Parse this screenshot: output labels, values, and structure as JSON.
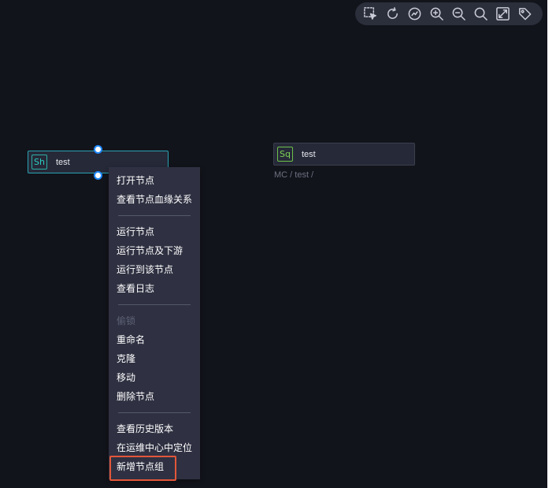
{
  "toolbar": {
    "tools": [
      {
        "icon": "select-box-icon"
      },
      {
        "icon": "refresh-icon"
      },
      {
        "icon": "auto-layout-icon"
      },
      {
        "icon": "zoom-in-icon"
      },
      {
        "icon": "zoom-out-icon"
      },
      {
        "icon": "search-icon"
      },
      {
        "icon": "fullscreen-icon"
      },
      {
        "icon": "tag-icon"
      }
    ]
  },
  "nodes": {
    "shell": {
      "badge": "Sh",
      "name": "test"
    },
    "sql": {
      "badge": "Sq",
      "name": "test",
      "path": "MC / test /"
    }
  },
  "context_menu": {
    "open_node": "打开节点",
    "view_lineage": "查看节点血缘关系",
    "run_node": "运行节点",
    "run_node_downstream": "运行节点及下游",
    "run_to_node": "运行到该节点",
    "view_log": "查看日志",
    "steal_lock": "偷锁",
    "rename": "重命名",
    "clone": "克隆",
    "move": "移动",
    "delete_node": "删除节点",
    "view_history": "查看历史版本",
    "locate_in_ops": "在运维中心中定位",
    "add_node_group": "新增节点组"
  },
  "colors": {
    "canvas_bg": "#12141b",
    "menu_bg": "#2f3142",
    "selected_border": "#27a3b3",
    "highlight": "#e2563a"
  }
}
